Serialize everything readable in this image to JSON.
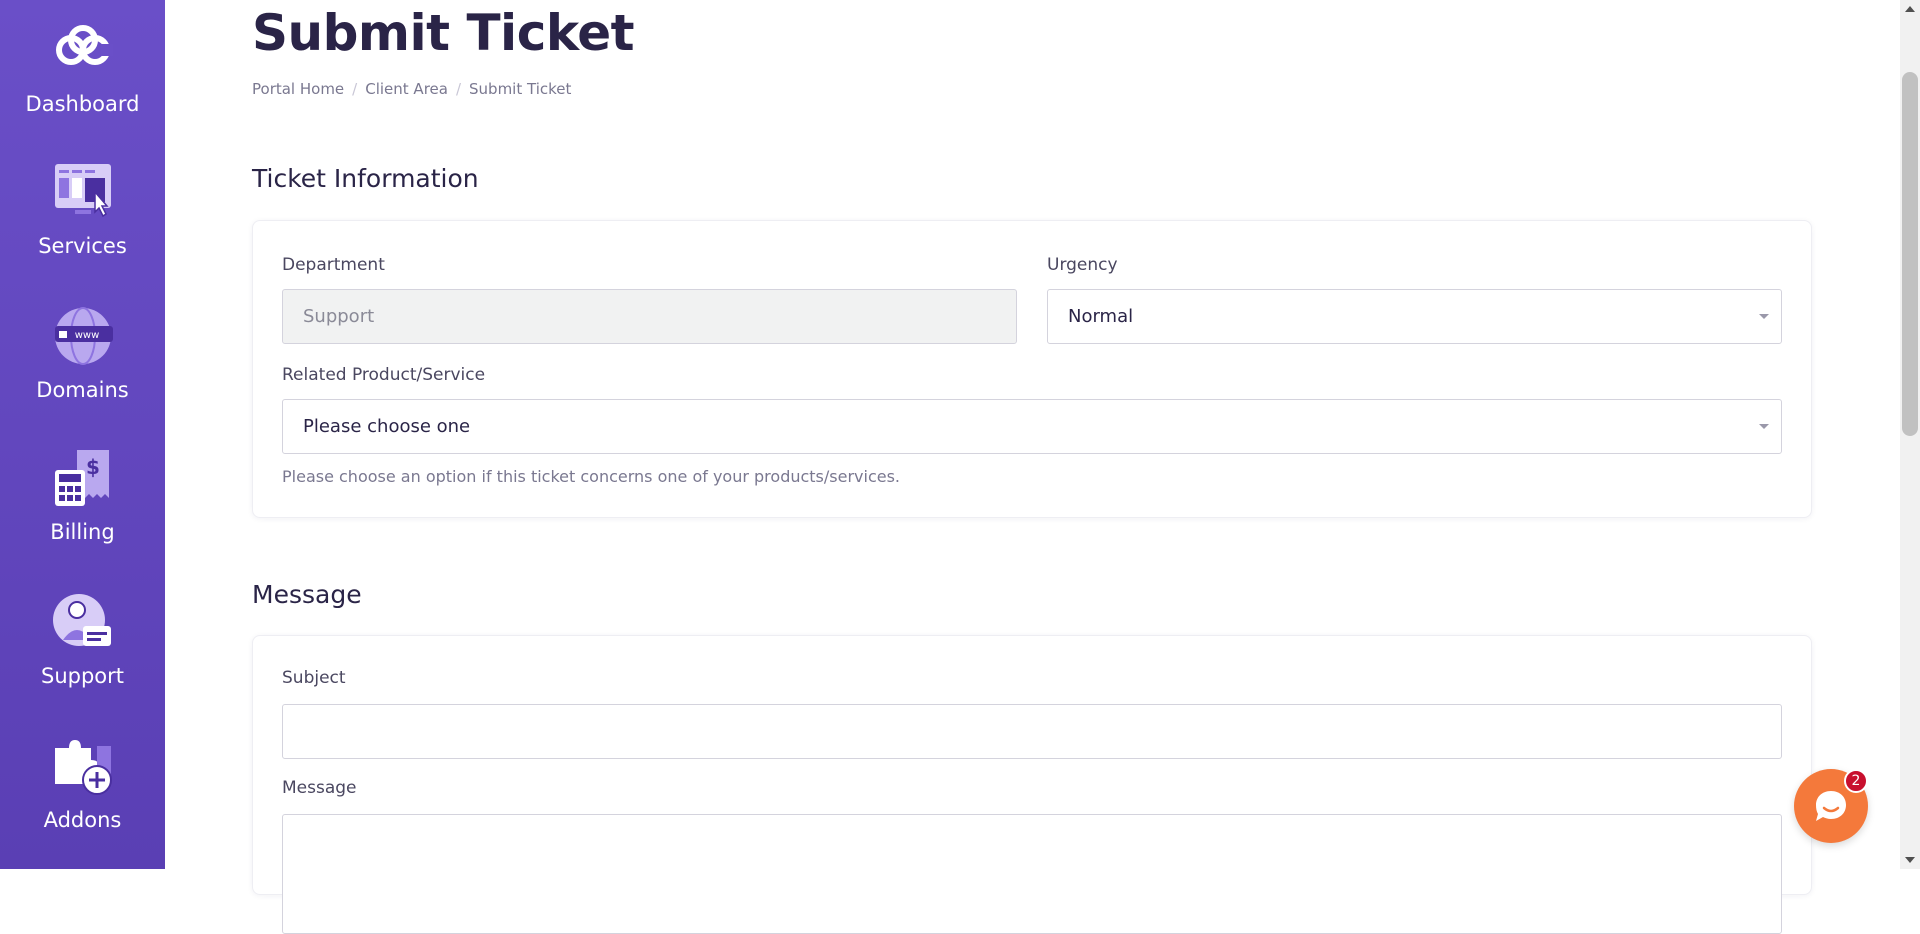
{
  "sidebar": {
    "items": [
      {
        "label": "Dashboard",
        "icon": "dashboard-logo-icon"
      },
      {
        "label": "Services",
        "icon": "services-icon"
      },
      {
        "label": "Domains",
        "icon": "domains-globe-icon"
      },
      {
        "label": "Billing",
        "icon": "billing-calculator-icon"
      },
      {
        "label": "Support",
        "icon": "support-agent-icon"
      },
      {
        "label": "Addons",
        "icon": "addons-puzzle-icon"
      }
    ]
  },
  "page": {
    "title": "Submit Ticket",
    "breadcrumb": [
      "Portal Home",
      "Client Area",
      "Submit Ticket"
    ]
  },
  "ticket_info": {
    "heading": "Ticket Information",
    "department_label": "Department",
    "department_value": "Support",
    "urgency_label": "Urgency",
    "urgency_value": "Normal",
    "related_label": "Related Product/Service",
    "related_value": "Please choose one",
    "related_help": "Please choose an option if this ticket concerns one of your products/services."
  },
  "message_section": {
    "heading": "Message",
    "subject_label": "Subject",
    "subject_value": "",
    "message_label": "Message",
    "message_value": ""
  },
  "chat_widget": {
    "badge_count": "2"
  },
  "colors": {
    "sidebar": "#6a4fc8",
    "accent_orange": "#f4793b",
    "badge_red": "#c8102e",
    "title_text": "#2a2447"
  }
}
